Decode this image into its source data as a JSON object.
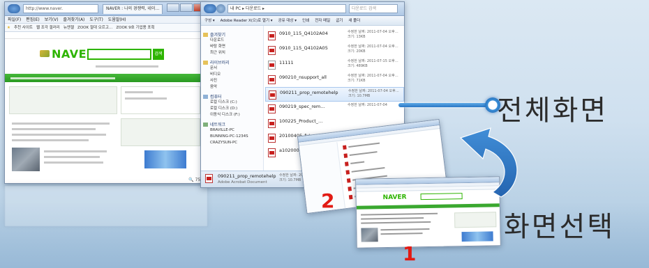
{
  "browser": {
    "address": "http://www.naver.",
    "tab": "NAVER : 나의 경쟁력, 네이…",
    "menu": [
      "파일(F)",
      "편집(E)",
      "보기(V)",
      "즐겨찾기(A)",
      "도구(T)",
      "도움말(H)"
    ],
    "favorites": [
      "추천 사이트",
      "웹 조각 갤러리",
      "뉴엔젤",
      "ZOOK 절대 오르고…",
      "ZOOK 9호 기업용 포획"
    ],
    "logo": "NAVER",
    "search_button": "검색",
    "zoom": "75%"
  },
  "explorer": {
    "path": "내 PC ▸ 다운로드 ▸",
    "search_placeholder": "다운로드 검색",
    "toolbar": [
      "구성 ▾",
      "Adobe Reader X(으)로 열기 ▾",
      "공유 대상 ▾",
      "인쇄",
      "전자 메일",
      "굽기",
      "새 폴더"
    ],
    "sidebar": {
      "favorites_header": "즐겨찾기",
      "favorites": [
        "다운로드",
        "바탕 화면",
        "최근 위치"
      ],
      "libraries_header": "라이브러리",
      "libraries": [
        "문서",
        "비디오",
        "사진",
        "음악"
      ],
      "computer_header": "컴퓨터",
      "computer": [
        "로컬 디스크 (C:)",
        "로컬 디스크 (D:)",
        "이동식 디스크 (F:)"
      ],
      "network_header": "네트워크",
      "network": [
        "BRAVILLE-PC",
        "BUNNING-PC-1234S",
        "CRAZYSUN-PC"
      ]
    },
    "files": [
      {
        "name": "0910_115_Q4102A04",
        "modified": "수정한 날짜: 2011-07-04 오후…",
        "size": "크기: 13KB"
      },
      {
        "name": "0910_115_Q4102A05",
        "modified": "수정한 날짜: 2011-07-04 오후…",
        "size": "크기: 20KB"
      },
      {
        "name": "11111",
        "modified": "수정한 날짜: 2011-07-15 오후…",
        "size": "크기: 489KB"
      },
      {
        "name": "090210_nsupport_all",
        "modified": "수정한 날짜: 2011-07-04 오후…",
        "size": "크기: 71KB"
      },
      {
        "name": "090211_prop_remotehelp",
        "modified": "수정한 날짜: 2011-07-04 오후…",
        "size": "크기: 10.7MB"
      },
      {
        "name": "090219_spec_rem…",
        "modified": "수정한 날짜: 2011-07-04",
        "size": ""
      },
      {
        "name": "100225_Product_…",
        "modified": "",
        "size": ""
      },
      {
        "name": "20100405_future…",
        "modified": "",
        "size": ""
      },
      {
        "name": "a1020002009",
        "modified": "",
        "size": ""
      }
    ],
    "status": {
      "name": "090211_prop_remotehelp",
      "type": "Adobe Acrobat Document",
      "modified": "수정한 날짜: 2011-07-04 오…",
      "size": "크기: 10.7MB"
    }
  },
  "labels": {
    "full_screen": "전체화면",
    "select_screen": "화면선택",
    "num_two": "2",
    "num_one": "1"
  },
  "colors": {
    "naver_green": "#2db400",
    "accent_blue": "#2a76c4",
    "number_red": "#e21b14"
  }
}
